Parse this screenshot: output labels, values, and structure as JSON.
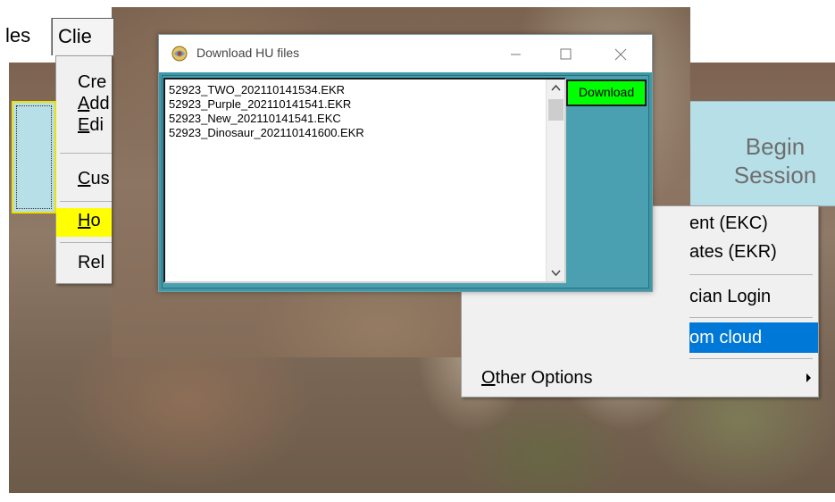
{
  "menubar": {
    "files_label": "les",
    "clients_label": "Clie"
  },
  "clients_menu": {
    "items": [
      {
        "label": "Cre",
        "underline": ""
      },
      {
        "label": "dd",
        "underline": "A"
      },
      {
        "label": "di",
        "underline": "E"
      },
      {
        "label": "us",
        "underline": "C"
      },
      {
        "label": "o",
        "underline": "H"
      },
      {
        "label": "Rel",
        "underline": ""
      }
    ],
    "highlight_color": "#ffff00"
  },
  "begin_session": {
    "line1": "Begin",
    "line2": "Session"
  },
  "context_menu": {
    "items": [
      {
        "label": "ent (EKC)"
      },
      {
        "label": "ates (EKR)"
      },
      {
        "label": "cian Login"
      },
      {
        "label": "om cloud"
      }
    ],
    "other_options": {
      "underline": "O",
      "label": "ther Options"
    },
    "selected_color": "#0078d7"
  },
  "download_window": {
    "title": "Download HU files",
    "files": [
      "52923_TWO_202110141534.EKR",
      "52923_Purple_202110141541.EKR",
      "52923_New_202110141541.EKC",
      "52923_Dinosaur_202110141600.EKR"
    ],
    "download_label": "Download",
    "download_color": "#00ff00",
    "body_color": "#3d99a8"
  }
}
